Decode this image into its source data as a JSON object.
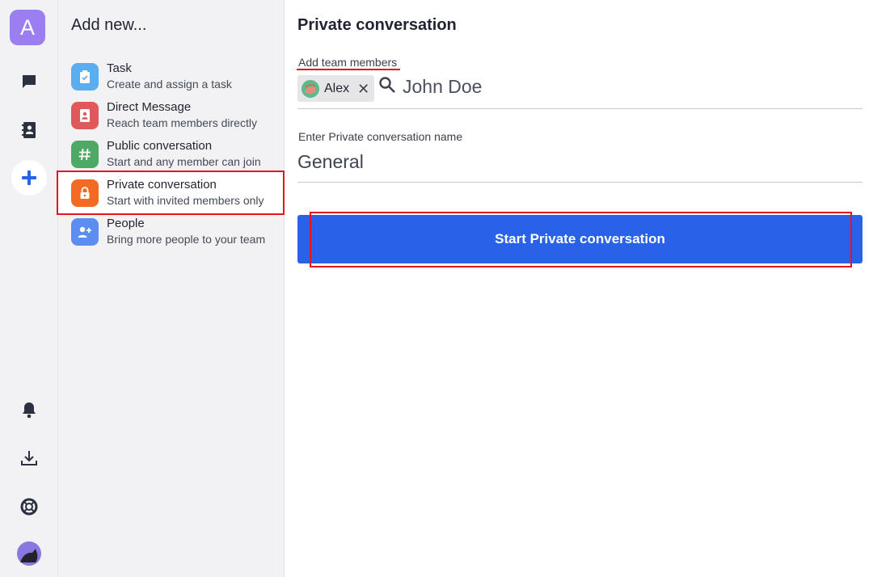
{
  "rail": {
    "workspace_letter": "A",
    "icons": [
      "chat-icon",
      "contacts-icon",
      "add-icon",
      "bell-icon",
      "download-icon",
      "help-icon",
      "user-avatar"
    ],
    "accent": "#2962e6"
  },
  "panel": {
    "title": "Add new...",
    "options": [
      {
        "title": "Task",
        "desc": "Create and assign a task",
        "icon": "clipboard-icon",
        "color": "#5aaef0"
      },
      {
        "title": "Direct Message",
        "desc": "Reach team members directly",
        "icon": "contact-card-icon",
        "color": "#e05858"
      },
      {
        "title": "Public conversation",
        "desc": "Start and any member can join",
        "icon": "hash-icon",
        "color": "#4caa64"
      },
      {
        "title": "Private conversation",
        "desc": "Start with invited members only",
        "icon": "lock-icon",
        "color": "#f56a22"
      },
      {
        "title": "People",
        "desc": "Bring more people to your team",
        "icon": "add-person-icon",
        "color": "#5b8ef0"
      }
    ],
    "selected_index": 3
  },
  "main": {
    "title": "Private conversation",
    "members_label": "Add team members",
    "member_chip": "Alex",
    "members_placeholder": "John Doe",
    "name_label": "Enter Private conversation name",
    "name_value": "General",
    "start_button": "Start Private conversation"
  }
}
